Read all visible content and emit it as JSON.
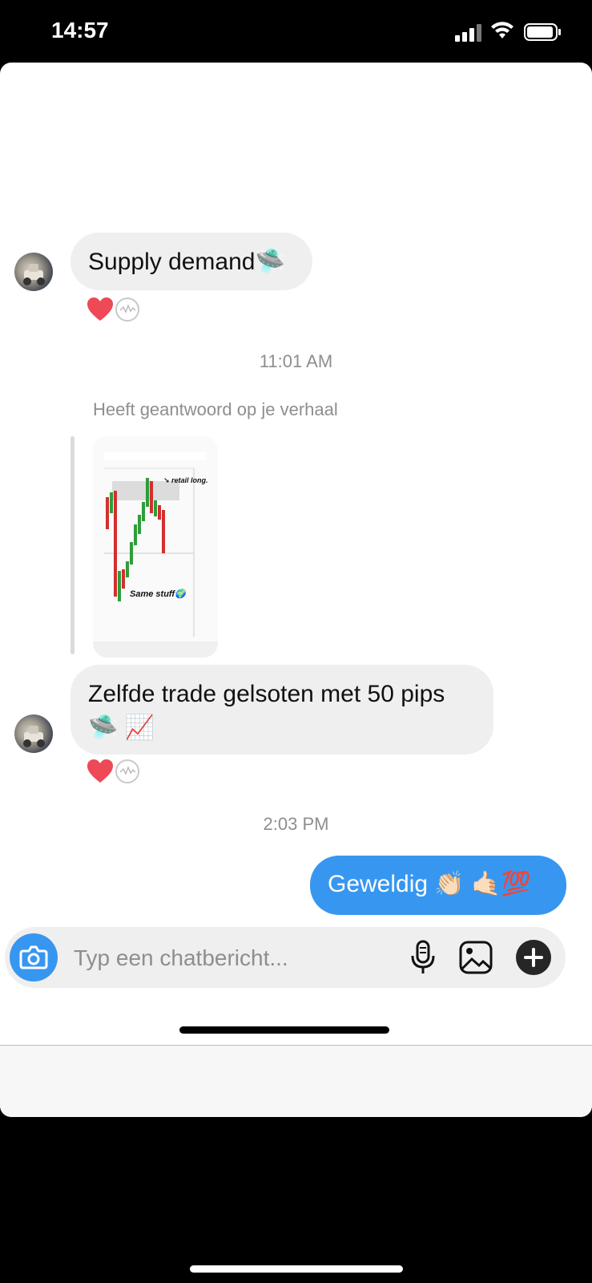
{
  "status_bar": {
    "time": "14:57"
  },
  "messages": [
    {
      "text": "Supply demand🛸"
    },
    {
      "timestamp": "11:01 AM"
    },
    {
      "reply_label": "Heeft geantwoord op je verhaal",
      "story": {
        "chart_annotation_top": "↘ retail long.",
        "chart_annotation_bottom": "Same stuff🌍"
      }
    },
    {
      "text_line1": "Zelfde trade gelsoten met 50 pips",
      "text_line2": "🛸 📈"
    },
    {
      "timestamp": "2:03 PM"
    },
    {
      "text": "Geweldig 👏🏻 🤙🏻💯"
    }
  ],
  "composer": {
    "placeholder": "Typ een chatbericht..."
  },
  "icons": {
    "camera": "camera-icon",
    "mic": "microphone-icon",
    "gallery": "image-icon",
    "plus": "plus-circle-icon",
    "heart": "heart-icon"
  },
  "colors": {
    "accent": "#3797f0",
    "incoming_bubble": "#efefef",
    "heart": "#ed4956"
  }
}
